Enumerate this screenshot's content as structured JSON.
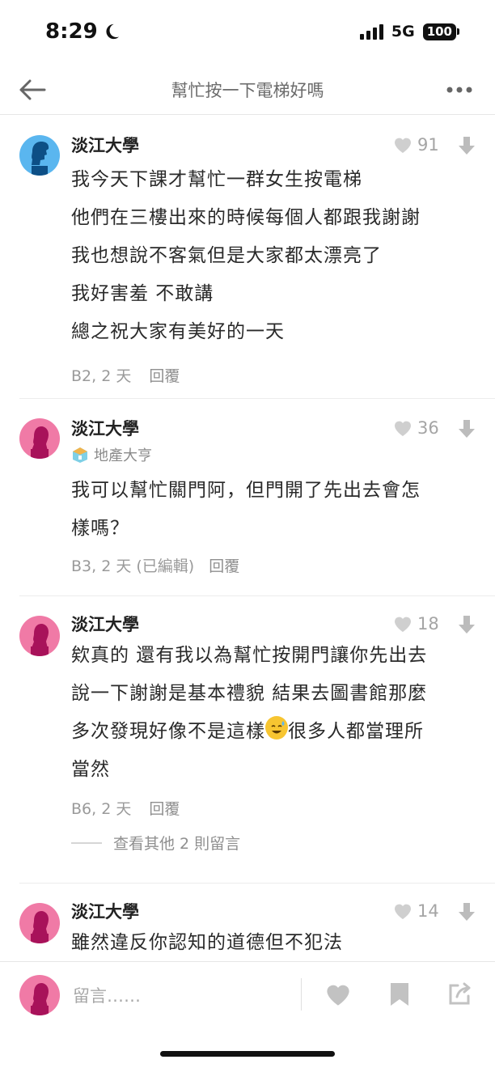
{
  "status_bar": {
    "time": "8:29",
    "network": "5G",
    "battery": "100"
  },
  "nav": {
    "title": "幫忙按一下電梯好嗎"
  },
  "comments": [
    {
      "author": "淡江大學",
      "likes": "91",
      "lines": [
        "我今天下課才幫忙一群女生按電梯",
        "他們在三樓出來的時候每個人都跟我謝謝",
        "我也想說不客氣但是大家都太漂亮了",
        "我好害羞 不敢講",
        "總之祝大家有美好的一天"
      ],
      "meta": "B2, 2 天",
      "reply_label": "回覆"
    },
    {
      "author": "淡江大學",
      "school_badge": "地產大亨",
      "likes": "36",
      "lines": [
        "我可以幫忙關門阿，但門開了先出去會怎",
        "樣嗎？"
      ],
      "meta": "B3, 2 天 (已編輯)",
      "reply_label": "回覆"
    },
    {
      "author": "淡江大學",
      "likes": "18",
      "lines": [
        "欸真的 還有我以為幫忙按開門讓你先出去",
        "說一下謝謝是基本禮貌 結果去圖書館那麼",
        "很多人都當理所",
        "當然"
      ],
      "line3_prefix": "多次發現好像不是這樣",
      "meta": "B6, 2 天",
      "reply_label": "回覆",
      "more_replies": "查看其他 2 則留言"
    },
    {
      "author": "淡江大學",
      "likes": "14",
      "lines": [
        "雖然違反你認知的道德但不犯法"
      ]
    }
  ],
  "compose": {
    "placeholder": "留言……"
  },
  "colors": {
    "avatar_blue": "#5ab6ef",
    "avatar_pink": "#f07aa6",
    "muted": "#a5a5a5"
  },
  "icons": [
    "back-arrow-icon",
    "more-icon",
    "heart-icon",
    "downvote-icon",
    "bookmark-icon",
    "share-icon",
    "house-icon",
    "sweat-smile-emoji-icon"
  ]
}
